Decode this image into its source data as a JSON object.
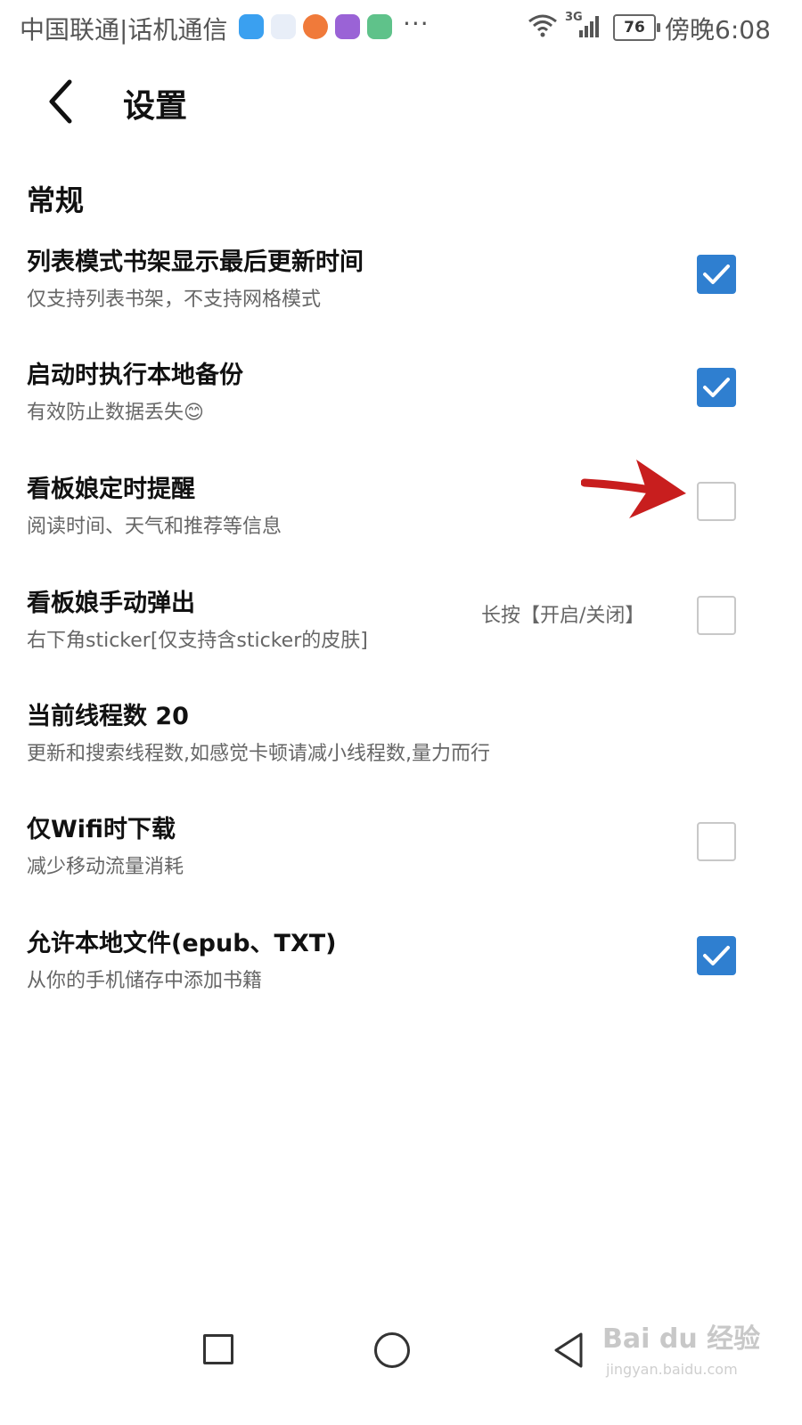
{
  "status_bar": {
    "carrier": "中国联通|话机通信",
    "icons": [
      "shield-app-icon",
      "news-app-icon",
      "browser-app-icon",
      "chart-app-icon",
      "health-app-icon"
    ],
    "more": "···",
    "network": "3G",
    "battery": "76",
    "time": "傍晚6:08"
  },
  "header": {
    "back_icon": "chevron-left-icon",
    "title": "设置"
  },
  "section": {
    "title": "常规"
  },
  "settings": [
    {
      "title": "列表模式书架显示最后更新时间",
      "subtitle": "仅支持列表书架，不支持网格模式",
      "checked": true
    },
    {
      "title": "启动时执行本地备份",
      "subtitle": "有效防止数据丢失😊",
      "checked": true
    },
    {
      "title": "看板娘定时提醒",
      "subtitle": "阅读时间、天气和推荐等信息",
      "checked": false
    },
    {
      "title": "看板娘手动弹出",
      "subtitle": "右下角sticker[仅支持含sticker的皮肤]",
      "hint": "长按【开启/关闭】",
      "checked": false
    },
    {
      "title": "当前线程数 20",
      "subtitle": "更新和搜索线程数,如感觉卡顿请减小线程数,量力而行"
    },
    {
      "title": "仅Wifi时下载",
      "subtitle": "减少移动流量消耗",
      "checked": false
    },
    {
      "title": "允许本地文件(epub、TXT)",
      "subtitle": "从你的手机储存中添加书籍",
      "checked": true
    }
  ],
  "annotation": {
    "icon": "red-arrow-icon",
    "color": "#c81e1e"
  },
  "colors": {
    "accent": "#2f7fd0"
  },
  "nav_bar": {
    "recents_icon": "square-icon",
    "home_icon": "circle-icon",
    "back_icon": "triangle-back-icon"
  },
  "watermark": {
    "text": "Bai du 经验",
    "sub": "jingyan.baidu.com"
  }
}
